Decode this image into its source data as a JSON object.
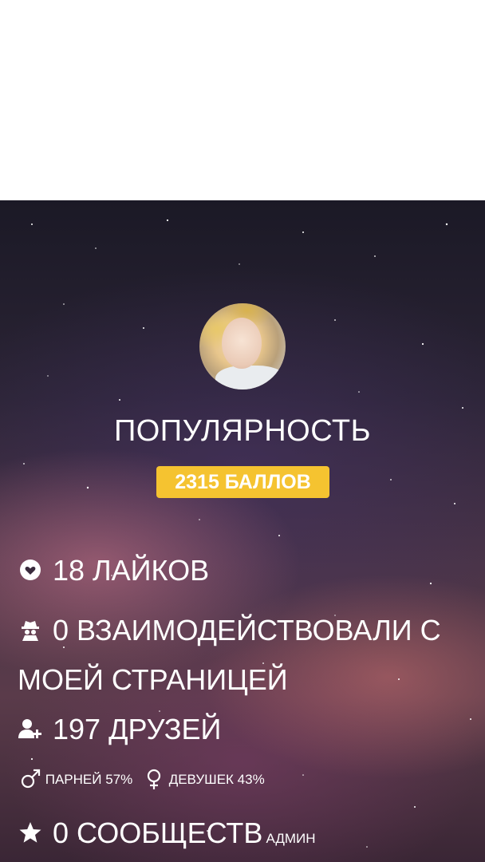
{
  "profile": {
    "title": "ПОПУЛЯРНОСТЬ",
    "points_badge": "2315 БАЛЛОВ"
  },
  "stats": {
    "likes": "18 ЛАЙКОВ",
    "visitors": "0 ВЗАИМОДЕЙСТВОВАЛИ С МОЕЙ СТРАНИЦЕЙ",
    "friends": "197 ДРУЗЕЙ",
    "male": "ПАРНЕЙ 57%",
    "female": "ДЕВУШЕК 43%",
    "communities": "0 СООБЩЕСТВ",
    "communities_suffix": "АДМИН"
  },
  "icons": {
    "likes": "heart-icon",
    "visitors": "spy-icon",
    "friends": "add-user-icon",
    "male": "male-icon",
    "female": "female-icon",
    "communities": "star-icon"
  },
  "colors": {
    "badge": "#f5c330",
    "text": "#ffffff"
  }
}
